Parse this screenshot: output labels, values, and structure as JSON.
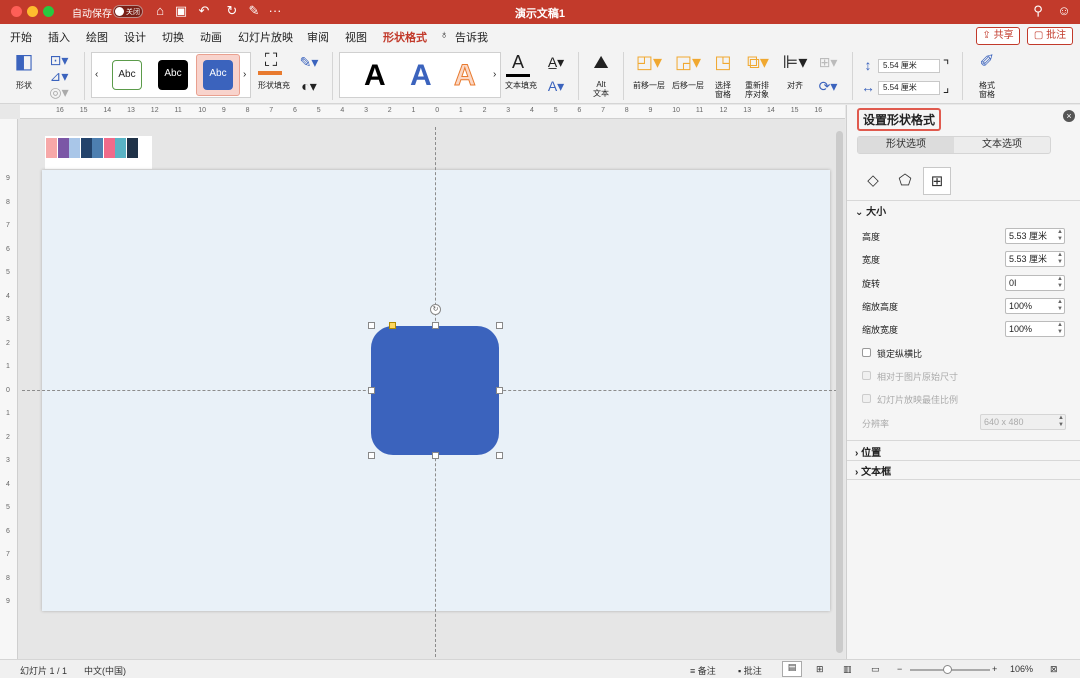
{
  "titlebar": {
    "autosave_label": "自动保存",
    "toggle_label": "关闭",
    "doc_title": "演示文稿1",
    "more": "···"
  },
  "tabs": [
    "开始",
    "插入",
    "绘图",
    "设计",
    "切换",
    "动画",
    "幻灯片放映",
    "审阅",
    "视图",
    "形状格式",
    "告诉我"
  ],
  "active_tab": "形状格式",
  "share_label": "共享",
  "comment_label": "批注",
  "ribbon": {
    "shape_label": "形状",
    "style_text": "Abc",
    "fill_label": "形状填充",
    "text_fill_label": "文本填充",
    "big_letter": "A",
    "alt_text_label": "Alt\n文本",
    "alt_line1": "Alt",
    "alt_line2": "文本",
    "bring_forward_label": "前移一层",
    "send_backward_label": "后移一层",
    "selection_pane_line1": "选择",
    "selection_pane_line2": "窗格",
    "reorder_line1": "重新排",
    "reorder_line2": "序对象",
    "align_label": "对齐",
    "height_value": "5.54 厘米",
    "width_value": "5.54 厘米",
    "format_pane_line1": "格式",
    "format_pane_line2": "窗格"
  },
  "ruler": {
    "top": [
      "16",
      "15",
      "14",
      "13",
      "12",
      "11",
      "10",
      "9",
      "8",
      "7",
      "6",
      "5",
      "4",
      "3",
      "2",
      "1",
      "0",
      "1",
      "2",
      "3",
      "4",
      "5",
      "6",
      "7",
      "8",
      "9",
      "10",
      "11",
      "12",
      "13",
      "14",
      "15",
      "16"
    ],
    "left": [
      "9",
      "8",
      "7",
      "6",
      "5",
      "4",
      "3",
      "2",
      "1",
      "0",
      "1",
      "2",
      "3",
      "4",
      "5",
      "6",
      "7",
      "8",
      "9"
    ]
  },
  "palette": [
    "#f7a8a8",
    "#7b57a6",
    "#a9c6e8",
    "#23436b",
    "#4d7fb0",
    "#f06b8a",
    "#59b3c5",
    "#1f3248"
  ],
  "shape": {
    "fill": "#3b63bd"
  },
  "panel": {
    "title": "设置形状格式",
    "tab_shape": "形状选项",
    "tab_text": "文本选项",
    "section_size": "大小",
    "height_label": "高度",
    "height_value": "5.53 厘米",
    "width_label": "宽度",
    "width_value": "5.53 厘米",
    "rotate_label": "旋转",
    "rotate_value": "0",
    "scale_h_label": "缩放高度",
    "scale_h_value": "100%",
    "scale_w_label": "缩放宽度",
    "scale_w_value": "100%",
    "lock_label": "锁定纵横比",
    "relative_label": "相对于图片原始尺寸",
    "best_scale_label": "幻灯片放映最佳比例",
    "resolution_label": "分辨率",
    "resolution_value": "640 x 480",
    "section_position": "位置",
    "section_textbox": "文本框"
  },
  "status": {
    "slide": "幻灯片 1 / 1",
    "language": "中文(中国)",
    "notes": "备注",
    "comments": "批注",
    "zoom": "106%"
  }
}
